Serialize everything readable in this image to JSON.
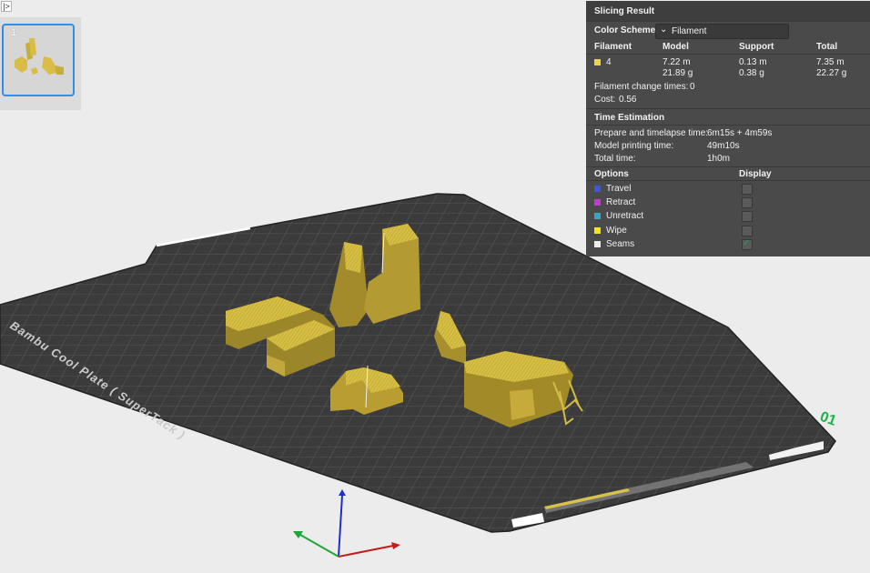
{
  "app": {
    "toggle_glyph": "|>",
    "accent_color": "#2f8fe8",
    "filament_color": "#d8c34a"
  },
  "plates": [
    {
      "number": "1",
      "selected": true
    }
  ],
  "viewport": {
    "plate_brand_text": "Bambu Cool Plate ( SuperTack )",
    "plate_index_label": "01",
    "axes": {
      "x_color": "#cc2222",
      "y_color": "#22aa22",
      "z_color": "#2233cc"
    }
  },
  "slicing_result": {
    "title": "Slicing Result",
    "color_scheme_label": "Color Scheme",
    "color_scheme_value": "Filament",
    "chevron_icon": "chevron-down-icon",
    "columns": {
      "filament": "Filament",
      "model": "Model",
      "support": "Support",
      "total": "Total"
    },
    "rows": [
      {
        "filament": "4",
        "color": "#e9d44a",
        "model_len": "7.22 m",
        "model_weight": "21.89 g",
        "support_len": "0.13 m",
        "support_weight": "0.38 g",
        "total_len": "7.35 m",
        "total_weight": "22.27 g"
      }
    ],
    "filament_change_label": "Filament change times:",
    "filament_change_value": "0",
    "cost_label": "Cost:",
    "cost_value": "0.56",
    "time_section_title": "Time Estimation",
    "prepare_label": "Prepare and timelapse time:",
    "prepare_value": "6m15s + 4m59s",
    "model_print_label": "Model printing time:",
    "model_print_value": "49m10s",
    "total_time_label": "Total time:",
    "total_time_value": "1h0m",
    "options_title": "Options",
    "display_title": "Display",
    "options": [
      {
        "label": "Travel",
        "color": "#3d57d6",
        "checked": false
      },
      {
        "label": "Retract",
        "color": "#c23ad1",
        "checked": false
      },
      {
        "label": "Unretract",
        "color": "#3aa4c7",
        "checked": false
      },
      {
        "label": "Wipe",
        "color": "#f2e51a",
        "checked": false
      },
      {
        "label": "Seams",
        "color": "#ededed",
        "checked": true
      }
    ]
  }
}
